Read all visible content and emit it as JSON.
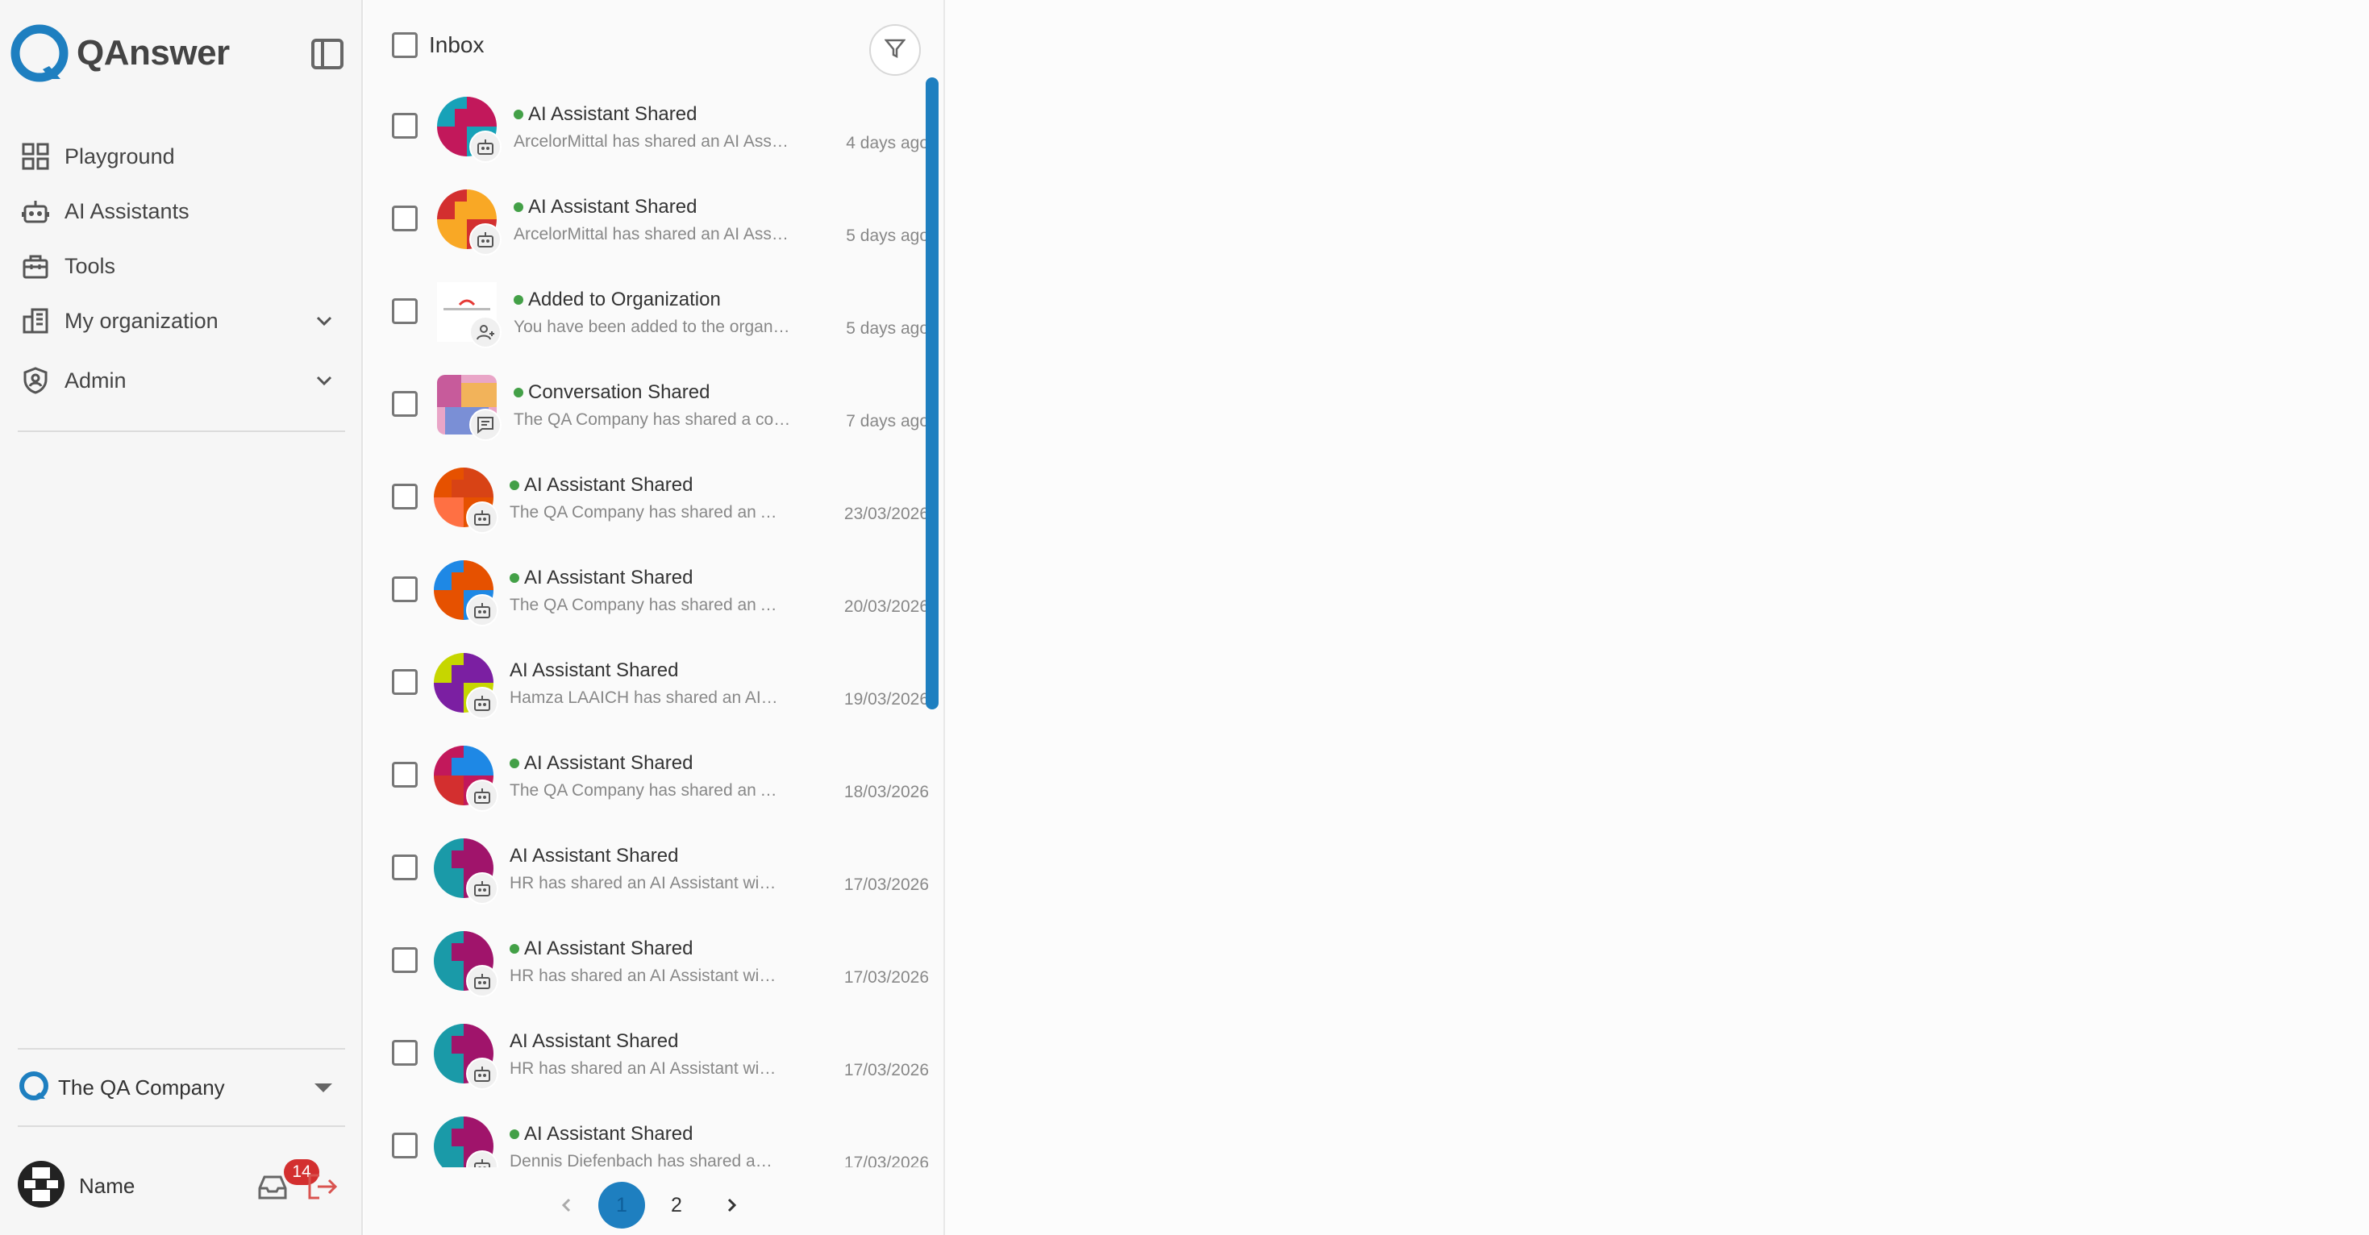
{
  "app": {
    "name": "QAnswer"
  },
  "colors": {
    "accent": "#1e7fc0",
    "unread_dot": "#43a047",
    "badge": "#d32f2f"
  },
  "sidebar": {
    "items": [
      {
        "label": "Playground",
        "icon": "grid-icon"
      },
      {
        "label": "AI Assistants",
        "icon": "robot-icon"
      },
      {
        "label": "Tools",
        "icon": "toolbox-icon"
      },
      {
        "label": "My organization",
        "icon": "building-icon",
        "expandable": true
      },
      {
        "label": "Admin",
        "icon": "shield-icon",
        "expandable": true
      }
    ],
    "organization": "The QA Company",
    "user_name": "Name",
    "notification_count": "14"
  },
  "inbox": {
    "title": "Inbox",
    "items": [
      {
        "title": "AI Assistant Shared",
        "subtitle": "ArcelorMittal has shared an AI Assistant with you",
        "date": "4 days ago",
        "unread": true,
        "type": "robot"
      },
      {
        "title": "AI Assistant Shared",
        "subtitle": "ArcelorMittal has shared an AI Assistant with you",
        "date": "5 days ago",
        "unread": true,
        "type": "robot"
      },
      {
        "title": "Added to Organization",
        "subtitle": "You have been added to the organization",
        "date": "5 days ago",
        "unread": true,
        "type": "user"
      },
      {
        "title": "Conversation Shared",
        "subtitle": "The QA Company has shared a conversation with you",
        "date": "7 days ago",
        "unread": true,
        "type": "chat"
      },
      {
        "title": "AI Assistant Shared",
        "subtitle": "The QA Company has shared an AI Assistant with you",
        "date": "23/03/2026",
        "unread": true,
        "type": "robot"
      },
      {
        "title": "AI Assistant Shared",
        "subtitle": "The QA Company has shared an AI Assistant with you",
        "date": "20/03/2026",
        "unread": true,
        "type": "robot"
      },
      {
        "title": "AI Assistant Shared",
        "subtitle": "Hamza LAAICH has shared an AI Assistant with you",
        "date": "19/03/2026",
        "unread": false,
        "type": "robot"
      },
      {
        "title": "AI Assistant Shared",
        "subtitle": "The QA Company has shared an AI Assistant with you",
        "date": "18/03/2026",
        "unread": true,
        "type": "robot"
      },
      {
        "title": "AI Assistant Shared",
        "subtitle": "HR has shared an AI Assistant with you",
        "date": "17/03/2026",
        "unread": false,
        "type": "robot"
      },
      {
        "title": "AI Assistant Shared",
        "subtitle": "HR has shared an AI Assistant with you",
        "date": "17/03/2026",
        "unread": true,
        "type": "robot"
      },
      {
        "title": "AI Assistant Shared",
        "subtitle": "HR has shared an AI Assistant with you",
        "date": "17/03/2026",
        "unread": false,
        "type": "robot"
      },
      {
        "title": "AI Assistant Shared",
        "subtitle": "Dennis Diefenbach has shared an AI Assistant with you",
        "date": "17/03/2026",
        "unread": true,
        "type": "robot"
      }
    ],
    "pagination": {
      "pages": [
        "1",
        "2"
      ],
      "current": "1"
    }
  }
}
